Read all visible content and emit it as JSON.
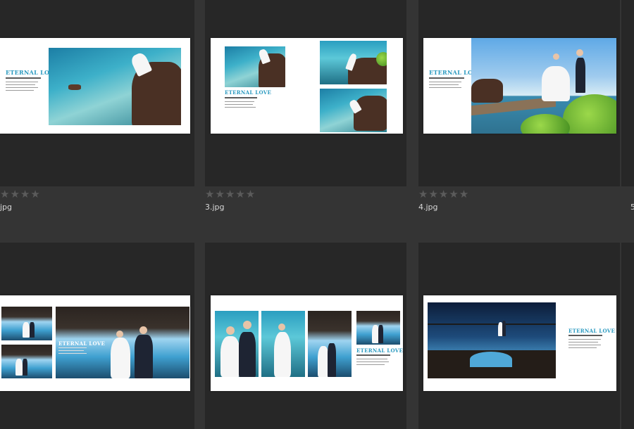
{
  "thumbnails": [
    {
      "filename": "jpg",
      "rating": 0,
      "stars": "★★★★"
    },
    {
      "filename": "3.jpg",
      "rating": 0,
      "stars": "★★★★★"
    },
    {
      "filename": "4.jpg",
      "rating": 0,
      "stars": "★★★★★"
    },
    {
      "filename": "5"
    },
    {
      "filename": "",
      "title": "ETERNAL LOVE"
    },
    {
      "filename": "",
      "title": "ETERNAL LOVE"
    },
    {
      "filename": "",
      "title": "ETERNAL LOVE"
    }
  ],
  "spread_titles": {
    "r1c1": "ETERNAL LOVE",
    "r1c2": "ETERNAL LOVE",
    "r1c3": "ETERNAL LOVE",
    "r2c1": "ETERNAL LOVE",
    "r2c2": "ETERNAL LOVE",
    "r2c3": "ETERNAL LOVE"
  },
  "colors": {
    "background": "#343434",
    "cell": "#272727",
    "accent": "#2b9ac0"
  }
}
